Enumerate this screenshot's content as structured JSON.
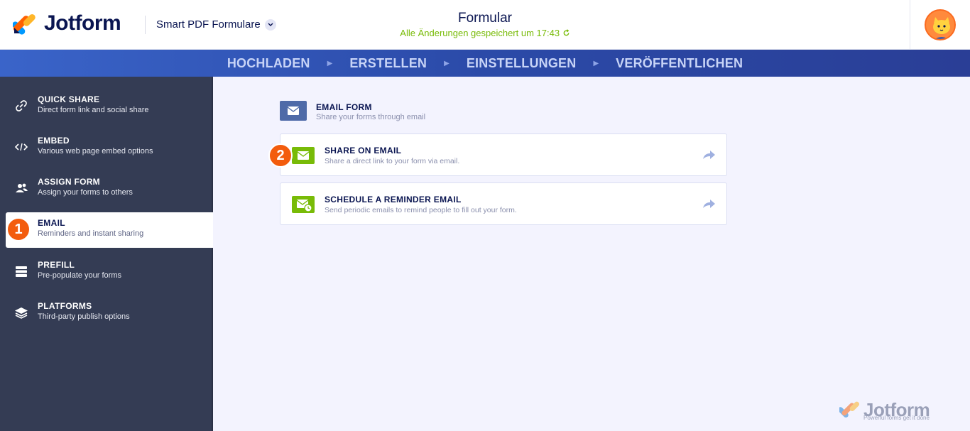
{
  "header": {
    "brand": "Jotform",
    "product": "Smart PDF Formulare",
    "form_title": "Formular",
    "saved_status": "Alle Änderungen gespeichert um 17:43",
    "saved_icon": "refresh-icon"
  },
  "nav": {
    "items": [
      "HOCHLADEN",
      "ERSTELLEN",
      "EINSTELLUNGEN",
      "VERÖFFENTLICHEN"
    ]
  },
  "sidebar": {
    "items": [
      {
        "title": "QUICK SHARE",
        "subtitle": "Direct form link and social share",
        "icon": "link-icon"
      },
      {
        "title": "EMBED",
        "subtitle": "Various web page embed options",
        "icon": "code-icon"
      },
      {
        "title": "ASSIGN FORM",
        "subtitle": "Assign your forms to others",
        "icon": "users-icon"
      },
      {
        "title": "EMAIL",
        "subtitle": "Reminders and instant sharing",
        "icon": "email-icon",
        "active": true
      },
      {
        "title": "PREFILL",
        "subtitle": "Pre-populate your forms",
        "icon": "database-icon"
      },
      {
        "title": "PLATFORMS",
        "subtitle": "Third-party publish options",
        "icon": "layers-icon"
      }
    ]
  },
  "main": {
    "section_title": "EMAIL FORM",
    "section_subtitle": "Share your forms through email",
    "cards": [
      {
        "title": "SHARE ON EMAIL",
        "subtitle": "Share a direct link to your form via email.",
        "icon": "envelope-icon"
      },
      {
        "title": "SCHEDULE A REMINDER EMAIL",
        "subtitle": "Send periodic emails to remind people to fill out your form.",
        "icon": "reminder-envelope-icon"
      }
    ]
  },
  "badges": {
    "step1": "1",
    "step2": "2"
  },
  "watermark": {
    "brand": "Jotform",
    "tagline": "Powerful forms get it done"
  },
  "colors": {
    "accent": "#f35c0d",
    "navy": "#0a1551",
    "green": "#78bb07",
    "sidebar": "#343c54",
    "nav": "#2b4aa8"
  }
}
